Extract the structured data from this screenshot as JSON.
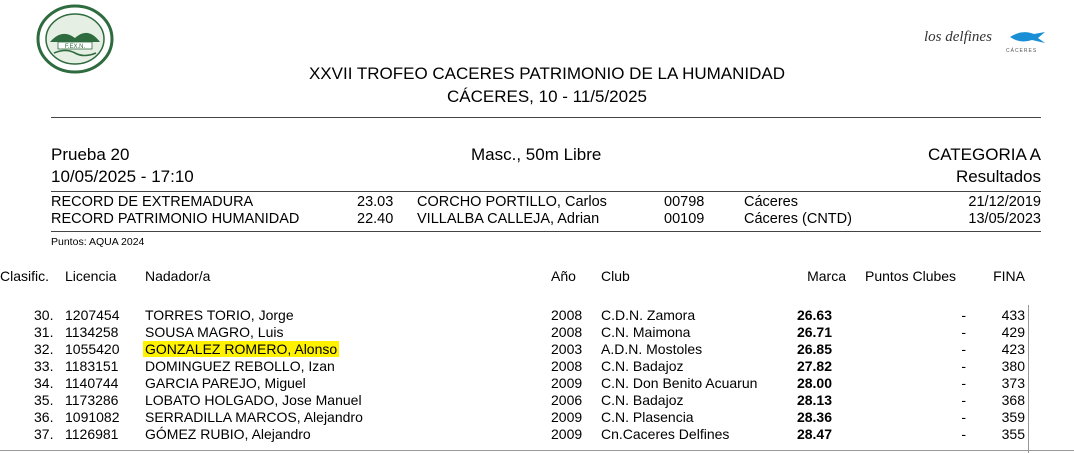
{
  "header": {
    "logo_left_text": "FEDERACION EXTREMEÑA DE NATACION",
    "logo_left_mark": "F.EX.N.",
    "logo_right_text": "los delfines",
    "logo_right_sub": "CÁCERES",
    "title_line1": "XXVII TROFEO CACERES PATRIMONIO DE LA HUMANIDAD",
    "title_line2": "CÁCERES, 10 - 11/5/2025"
  },
  "event": {
    "prueba": "Prueba 20",
    "datetime": "10/05/2025 - 17:10",
    "name": "Masc., 50m Libre",
    "category": "CATEGORIA A",
    "status": "Resultados"
  },
  "records": [
    {
      "label": "RECORD DE EXTREMADURA",
      "time": "23.03",
      "name": "CORCHO PORTILLO, Carlos",
      "license": "00798",
      "place": "Cáceres",
      "date": "21/12/2019"
    },
    {
      "label": "RECORD PATRIMONIO HUMANIDAD",
      "time": "22.40",
      "name": "VILLALBA CALLEJA, Adrian",
      "license": "00109",
      "place": "Cáceres (CNTD)",
      "date": "13/05/2023"
    }
  ],
  "points_note": "Puntos: AQUA 2024",
  "table": {
    "headers": {
      "clasif": "Clasific.",
      "licencia": "Licencia",
      "nadador": "Nadador/a",
      "ano": "Año",
      "club": "Club",
      "marca": "Marca",
      "puntos": "Puntos Clubes",
      "fina": "FINA"
    },
    "rows": [
      {
        "pos": "30.",
        "lic": "1207454",
        "name": "TORRES TORIO, Jorge",
        "year": "2008",
        "club": "C.D.N. Zamora",
        "time": "26.63",
        "pts": "-",
        "fina": "433"
      },
      {
        "pos": "31.",
        "lic": "1134258",
        "name": "SOUSA MAGRO, Luis",
        "year": "2008",
        "club": "C.N. Maimona",
        "time": "26.71",
        "pts": "-",
        "fina": "429"
      },
      {
        "pos": "32.",
        "lic": "1055420",
        "name": "GONZALEZ ROMERO, Alonso",
        "year": "2003",
        "club": "A.D.N. Mostoles",
        "time": "26.85",
        "pts": "-",
        "fina": "423"
      },
      {
        "pos": "33.",
        "lic": "1183151",
        "name": "DOMINGUEZ REBOLLO, Izan",
        "year": "2008",
        "club": "C.N. Badajoz",
        "time": "27.82",
        "pts": "-",
        "fina": "380"
      },
      {
        "pos": "34.",
        "lic": "1140744",
        "name": "GARCIA PAREJO, Miguel",
        "year": "2009",
        "club": "C.N. Don Benito Acuarun",
        "time": "28.00",
        "pts": "-",
        "fina": "373"
      },
      {
        "pos": "35.",
        "lic": "1173286",
        "name": "LOBATO HOLGADO, Jose Manuel",
        "year": "2006",
        "club": "C.N. Badajoz",
        "time": "28.13",
        "pts": "-",
        "fina": "368"
      },
      {
        "pos": "36.",
        "lic": "1091082",
        "name": "SERRADILLA MARCOS, Alejandro",
        "year": "2009",
        "club": "C.N. Plasencia",
        "time": "28.36",
        "pts": "-",
        "fina": "359"
      },
      {
        "pos": "37.",
        "lic": "1126981",
        "name": "GÓMEZ RUBIO, Alejandro",
        "year": "2009",
        "club": "Cn.Caceres Delfines",
        "time": "28.47",
        "pts": "-",
        "fina": "355"
      }
    ]
  },
  "colors": {
    "highlight": "#fff200",
    "logo_green": "#2e6b3e",
    "logo_blue": "#1b8fd6"
  }
}
